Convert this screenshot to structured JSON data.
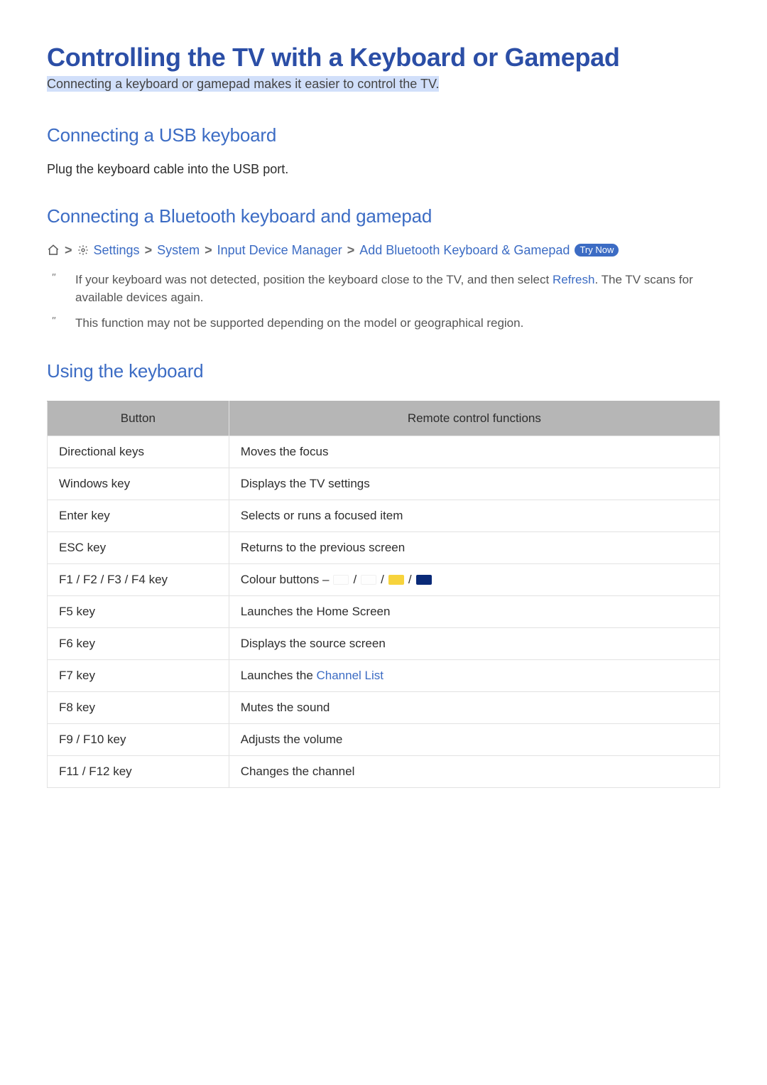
{
  "title": "Controlling the TV with a Keyboard or Gamepad",
  "subtitle": "Connecting a keyboard or gamepad makes it easier to control the TV.",
  "section_usb": {
    "heading": "Connecting a USB keyboard",
    "body": "Plug the keyboard cable into the USB port."
  },
  "section_bt": {
    "heading": "Connecting a Bluetooth keyboard and gamepad",
    "path": {
      "settings": "Settings",
      "system": "System",
      "idm": "Input Device Manager",
      "add": "Add Bluetooth Keyboard & Gamepad",
      "try_now": "Try Now"
    },
    "notes": [
      {
        "pre": "If your keyboard was not detected, position the keyboard close to the TV, and then select ",
        "link": "Refresh",
        "post": ". The TV scans for available devices again."
      },
      {
        "pre": "This function may not be supported depending on the model or geographical region.",
        "link": "",
        "post": ""
      }
    ]
  },
  "section_using": {
    "heading": "Using the keyboard",
    "th_button": "Button",
    "th_func": "Remote control functions",
    "rows": [
      {
        "btn": "Directional keys",
        "func": "Moves the focus"
      },
      {
        "btn": "Windows key",
        "func": "Displays the TV settings"
      },
      {
        "btn": "Enter key",
        "func": "Selects or runs a focused item"
      },
      {
        "btn": "ESC key",
        "func": "Returns to the previous screen"
      },
      {
        "btn": "F1 / F2 / F3 / F4 key",
        "func_prefix": "Colour buttons ‒ "
      },
      {
        "btn": "F5 key",
        "func": "Launches the Home Screen"
      },
      {
        "btn": "F6 key",
        "func": "Displays the source screen"
      },
      {
        "btn": "F7 key",
        "func_prefix": "Launches the ",
        "func_link": "Channel List"
      },
      {
        "btn": "F8 key",
        "func": "Mutes the sound"
      },
      {
        "btn": "F9 / F10 key",
        "func": "Adjusts the volume"
      },
      {
        "btn": "F11 / F12 key",
        "func": "Changes the channel"
      }
    ]
  }
}
